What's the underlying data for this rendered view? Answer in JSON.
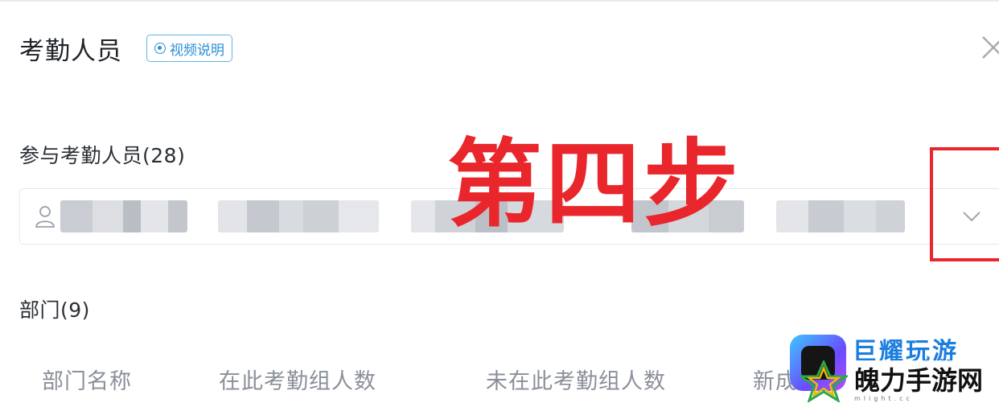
{
  "dialog": {
    "title": "考勤人员",
    "video_help_label": "视频说明"
  },
  "participants": {
    "label": "参与考勤人员(28)"
  },
  "departments": {
    "label": "部门(9)",
    "columns": [
      "部门名称",
      "在此考勤组人数",
      "未在此考勤组人数",
      "新成"
    ]
  },
  "annotation": {
    "text": "第四步",
    "color": "#e8262b"
  },
  "watermark": {
    "line1": "巨耀玩游",
    "line2": "魄力手游网",
    "sub": "mlight.cc"
  },
  "colors": {
    "accent": "#2b8fd6",
    "annotation_red": "#e8262b",
    "muted_text": "#8a8f99"
  }
}
